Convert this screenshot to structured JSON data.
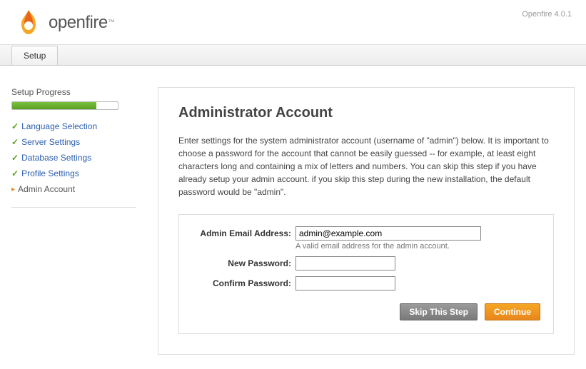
{
  "header": {
    "product_name": "openfire",
    "version": "Openfire 4.0.1"
  },
  "tab": {
    "label": "Setup"
  },
  "sidebar": {
    "title": "Setup Progress",
    "progress_percent": 80,
    "steps": [
      {
        "label": "Language Selection",
        "done": true
      },
      {
        "label": "Server Settings",
        "done": true
      },
      {
        "label": "Database Settings",
        "done": true
      },
      {
        "label": "Profile Settings",
        "done": true
      },
      {
        "label": "Admin Account",
        "done": false,
        "current": true
      }
    ]
  },
  "content": {
    "heading": "Administrator Account",
    "description": "Enter settings for the system administrator account (username of \"admin\") below. It is important to choose a password for the account that cannot be easily guessed -- for example, at least eight characters long and containing a mix of letters and numbers. You can skip this step if you have already setup your admin account. if you skip this step during the new installation, the default password would be \"admin\".",
    "form": {
      "email_label": "Admin Email Address:",
      "email_value": "admin@example.com",
      "email_hint": "A valid email address for the admin account.",
      "newpw_label": "New Password:",
      "newpw_value": "",
      "confirmpw_label": "Confirm Password:",
      "confirmpw_value": ""
    },
    "buttons": {
      "skip": "Skip This Step",
      "continue": "Continue"
    }
  }
}
